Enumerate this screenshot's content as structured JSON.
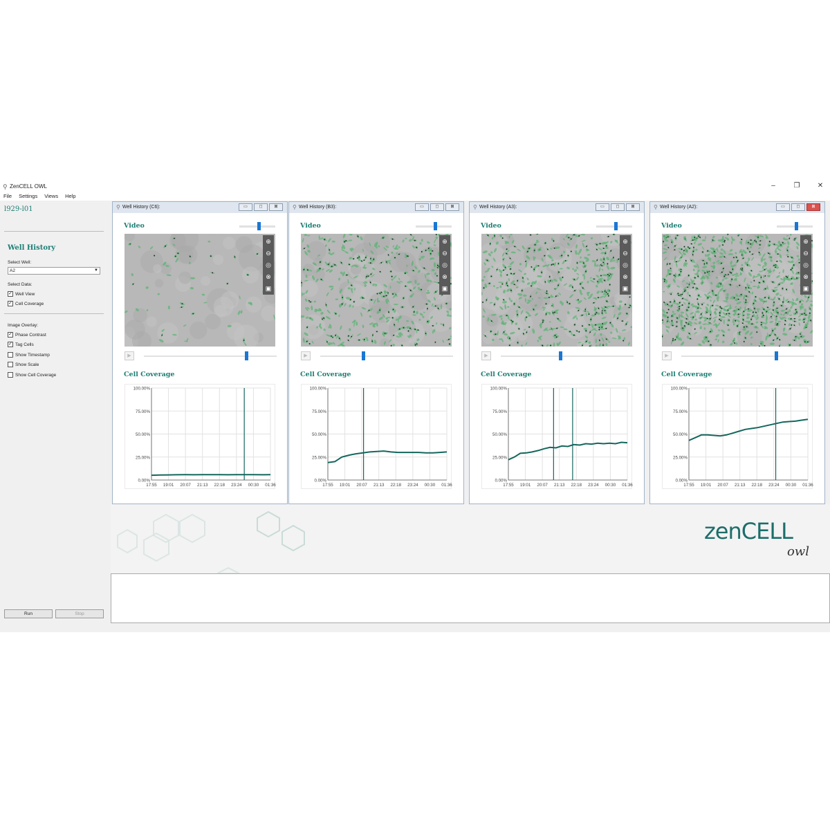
{
  "window": {
    "title": "ZenCELL OWL",
    "controls": [
      "–",
      "❐",
      "✕"
    ]
  },
  "menu": [
    "File",
    "Settings",
    "Views",
    "Help"
  ],
  "sidebar": {
    "project": "l929-l01",
    "section_title": "Well History",
    "select_well_label": "Select Well:",
    "select_well_value": "A2",
    "select_data_label": "Select Data:",
    "data_options": [
      {
        "label": "Well View",
        "checked": true
      },
      {
        "label": "Cell Coverage",
        "checked": true
      }
    ],
    "overlay_label": "Image Overlay:",
    "overlay_options": [
      {
        "label": "Phase Contrast",
        "checked": true
      },
      {
        "label": "Tag Cells",
        "checked": true
      },
      {
        "label": "Show Timestamp",
        "checked": false
      },
      {
        "label": "Show Scale",
        "checked": false
      },
      {
        "label": "Show Cell Coverage",
        "checked": false
      }
    ],
    "run_label": "Run",
    "stop_label": "Stop"
  },
  "panels": [
    {
      "title": "Well History (C6):",
      "video_label": "Video",
      "coverage_label": "Cell Coverage",
      "video_position": 0.55,
      "time_position": 0.78,
      "cell_density": 60,
      "chart_data": {
        "type": "line",
        "x": [
          "17:55",
          "19:01",
          "20:07",
          "21:13",
          "22:18",
          "23:24",
          "00:30",
          "01:36"
        ],
        "values": [
          5.2,
          5.4,
          5.6,
          5.7,
          5.8,
          5.7,
          5.9,
          5.8,
          5.9,
          5.7,
          5.8,
          5.9,
          5.8,
          5.7,
          5.8
        ],
        "markers": [
          0.78
        ],
        "yticks": [
          "100.00%",
          "75.00%",
          "50.00%",
          "25.00%",
          "0.00%"
        ],
        "ylim": [
          0,
          100
        ]
      }
    },
    {
      "title": "Well History (B3):",
      "video_label": "Video",
      "coverage_label": "Cell Coverage",
      "video_position": 0.55,
      "time_position": 0.32,
      "cell_density": 420,
      "chart_data": {
        "type": "line",
        "x": [
          "17:55",
          "19:01",
          "20:07",
          "21:13",
          "22:18",
          "23:24",
          "00:30",
          "01:36"
        ],
        "values": [
          19,
          20,
          25,
          27,
          28.5,
          29.5,
          30.5,
          31,
          31.5,
          30.5,
          30,
          30,
          30,
          30,
          29.5,
          29.5,
          30,
          30.5
        ],
        "markers": [
          0.3
        ],
        "yticks": [
          "100.00%",
          "75.00%",
          "50.00%",
          "25.00%",
          "0.00%"
        ],
        "ylim": [
          0,
          100
        ]
      }
    },
    {
      "title": "Well History (A3):",
      "video_label": "Video",
      "coverage_label": "Cell Coverage",
      "video_position": 0.55,
      "time_position": 0.45,
      "cell_density": 520,
      "chart_data": {
        "type": "line",
        "x": [
          "17:55",
          "19:01",
          "20:07",
          "21:13",
          "22:18",
          "23:24",
          "00:30",
          "01:36"
        ],
        "values": [
          22,
          25,
          29,
          29.5,
          30.5,
          32,
          34,
          35.5,
          35,
          37,
          36.5,
          38.5,
          38,
          39.5,
          39,
          40,
          39.5,
          40,
          39.5,
          41,
          40.5
        ],
        "markers": [
          0.38,
          0.54
        ],
        "yticks": [
          "100.00%",
          "75.00%",
          "50.00%",
          "25.00%",
          "0.00%"
        ],
        "ylim": [
          0,
          100
        ]
      }
    },
    {
      "title": "Well History (A2):",
      "video_label": "Video",
      "coverage_label": "Cell Coverage",
      "video_position": 0.55,
      "time_position": 0.72,
      "cell_density": 900,
      "chart_data": {
        "type": "line",
        "x": [
          "17:55",
          "19:01",
          "20:07",
          "21:13",
          "22:18",
          "23:24",
          "00:30",
          "01:36"
        ],
        "values": [
          43,
          46,
          49,
          49,
          48.5,
          48,
          49,
          51,
          53,
          55,
          56,
          57,
          58.5,
          60,
          61.5,
          63,
          63.5,
          64,
          65,
          66
        ],
        "markers": [
          0.73
        ],
        "yticks": [
          "100.00%",
          "75.00%",
          "50.00%",
          "25.00%",
          "0.00%"
        ],
        "ylim": [
          0,
          100
        ]
      }
    }
  ],
  "logo": {
    "main": "zenCELL",
    "sub": "owl"
  },
  "colors": {
    "accent": "#1d7e74",
    "slider": "#1877d5",
    "line": "#13665c",
    "cell": "#5fb377"
  }
}
